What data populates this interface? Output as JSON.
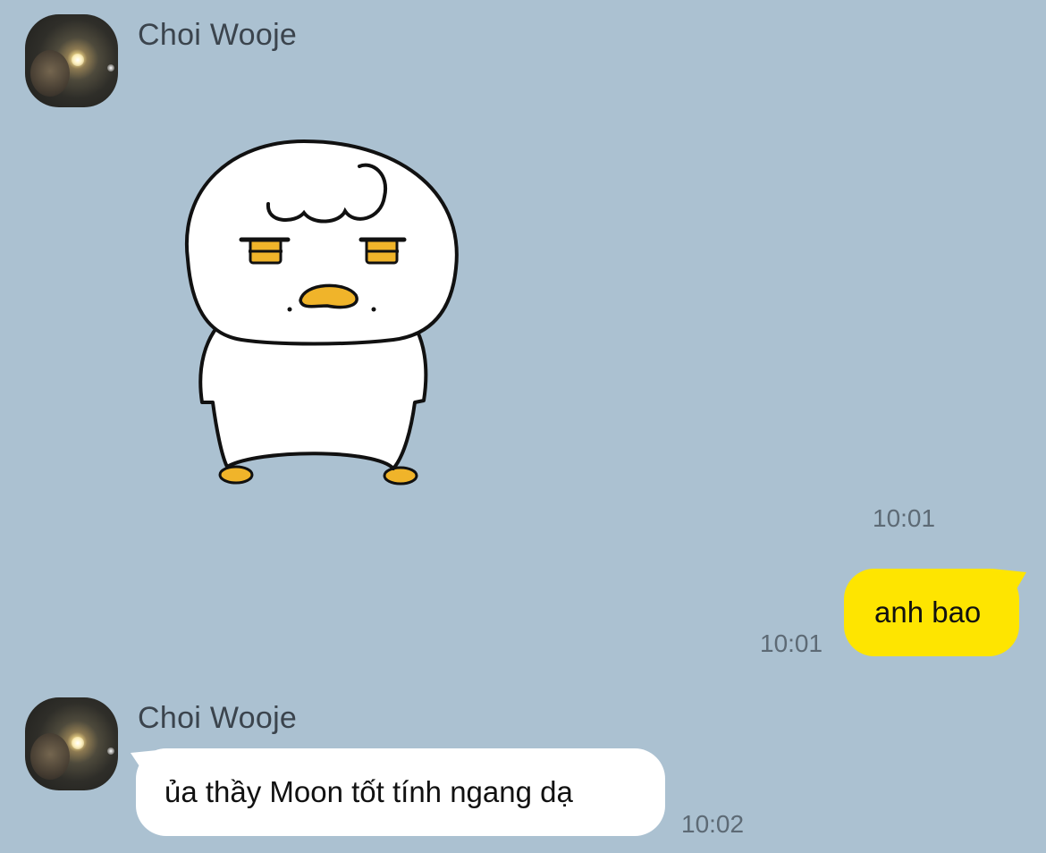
{
  "messages": [
    {
      "type": "sticker",
      "sender": "Choi Wooje",
      "sticker_icon": "duck-sticker-icon",
      "time": "10:01"
    },
    {
      "type": "text",
      "own": true,
      "text": "anh bao",
      "time": "10:01"
    },
    {
      "type": "text",
      "sender": "Choi Wooje",
      "text": "ủa thầy Moon tốt tính ngang dạ",
      "time": "10:02"
    }
  ],
  "colors": {
    "background": "#abc1d1",
    "own_bubble": "#fee500",
    "other_bubble": "#ffffff",
    "name_text": "#3b444d",
    "time_text": "#5d6a75"
  }
}
